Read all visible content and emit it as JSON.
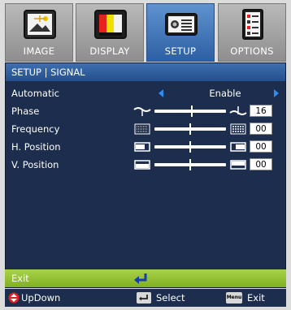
{
  "tabs": [
    {
      "label": "IMAGE",
      "icon": "image-icon"
    },
    {
      "label": "DISPLAY",
      "icon": "display-icon"
    },
    {
      "label": "SETUP",
      "icon": "projector-icon",
      "active": true
    },
    {
      "label": "OPTIONS",
      "icon": "options-icon"
    }
  ],
  "panel": {
    "title": "SETUP | SIGNAL",
    "automatic": {
      "label": "Automatic",
      "value": "Enable"
    },
    "phase": {
      "label": "Phase",
      "value": "16",
      "level": 0.52
    },
    "frequency": {
      "label": "Frequency",
      "value": "00",
      "level": 0.5
    },
    "h_position": {
      "label": "H. Position",
      "value": "00",
      "level": 0.5
    },
    "v_position": {
      "label": "V. Position",
      "value": "00",
      "level": 0.5
    }
  },
  "exit_row": {
    "label": "Exit"
  },
  "footer": {
    "updown": "UpDown",
    "select": "Select",
    "menu_key": "Menu",
    "exit": "Exit"
  },
  "colors": {
    "active_tab": "#3a6db0",
    "panel_bg": "#1c2d4d",
    "exit_bar": "#96c437",
    "arrow_blue": "#2f8cf0"
  }
}
